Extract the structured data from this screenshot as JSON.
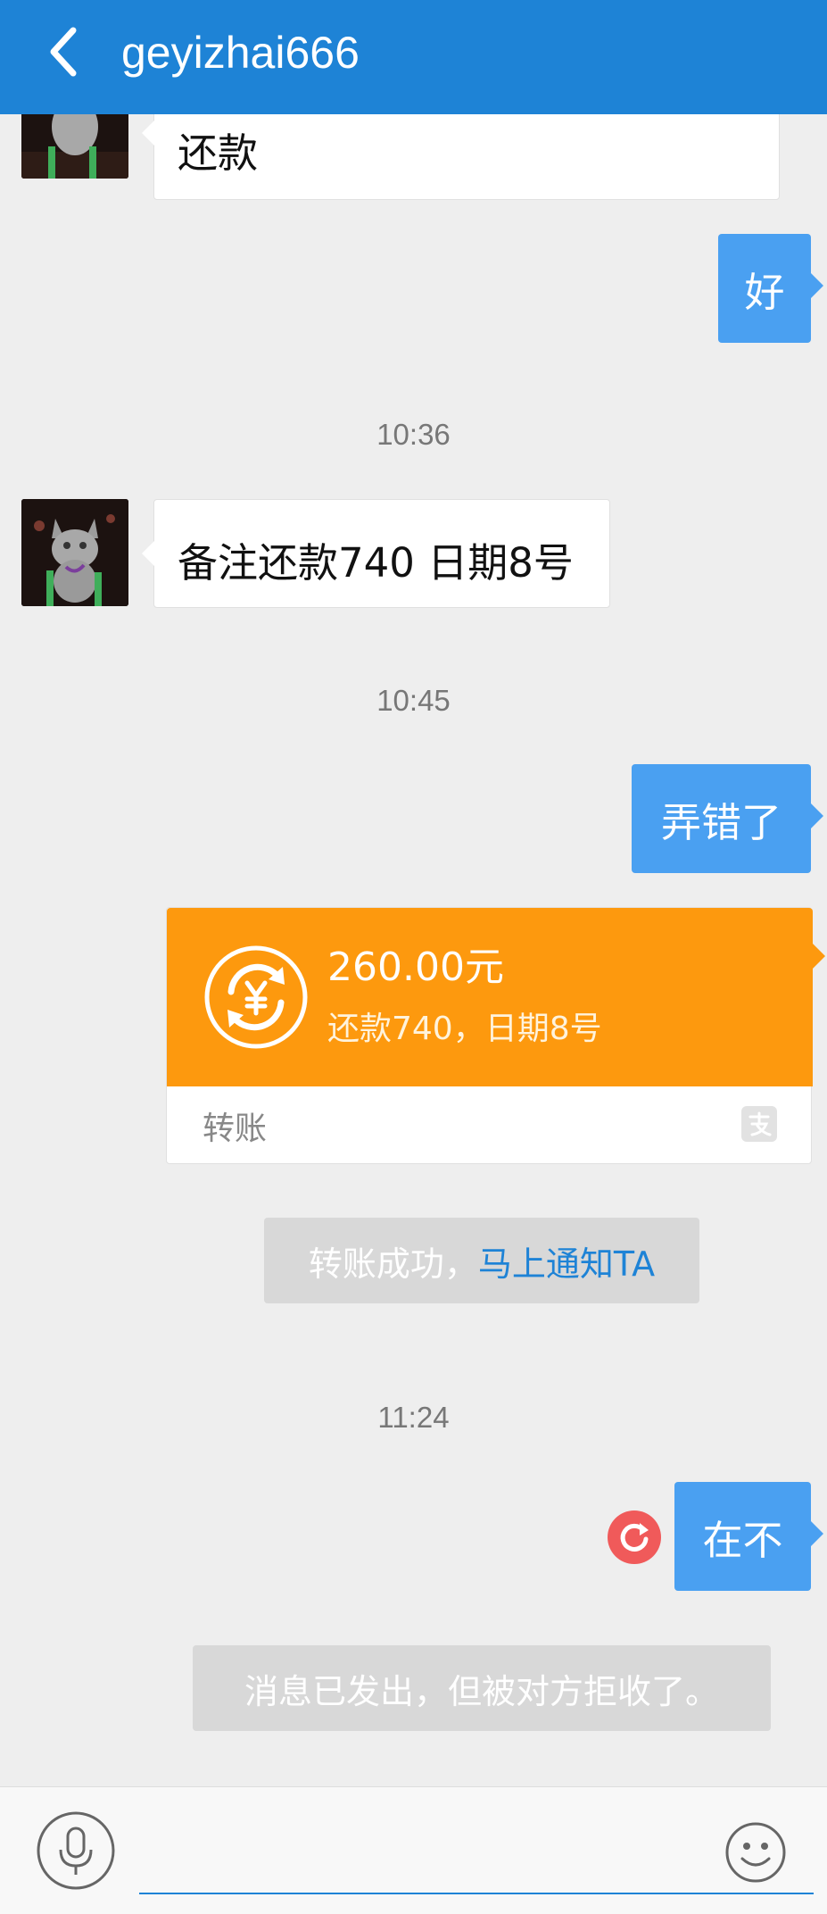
{
  "header": {
    "title": "geyizhai666"
  },
  "messages": {
    "partial_text": "还款",
    "reply_ok": "好",
    "time_1": "10:36",
    "note_msg": "备注还款740 日期8号",
    "time_2": "10:45",
    "mistake_msg": "弄错了",
    "transfer": {
      "amount": "260.00元",
      "note": "还款740，日期8号",
      "label": "转账"
    },
    "transfer_success": {
      "text": "转账成功，",
      "link": "马上通知TA"
    },
    "time_3": "11:24",
    "last_msg": "在不",
    "rejected_notice": "消息已发出，但被对方拒收了。"
  },
  "input": {
    "placeholder": ""
  },
  "colors": {
    "header": "#1e83d6",
    "bubble_blue": "#4aa0f1",
    "transfer_orange": "#fd990e",
    "resend_red": "#f05a5a"
  },
  "icons": {
    "back": "chevron-left-icon",
    "transfer": "transfer-yuan-icon",
    "alipay": "alipay-icon",
    "resend": "resend-icon",
    "mic": "microphone-icon",
    "emoji": "emoji-icon"
  }
}
